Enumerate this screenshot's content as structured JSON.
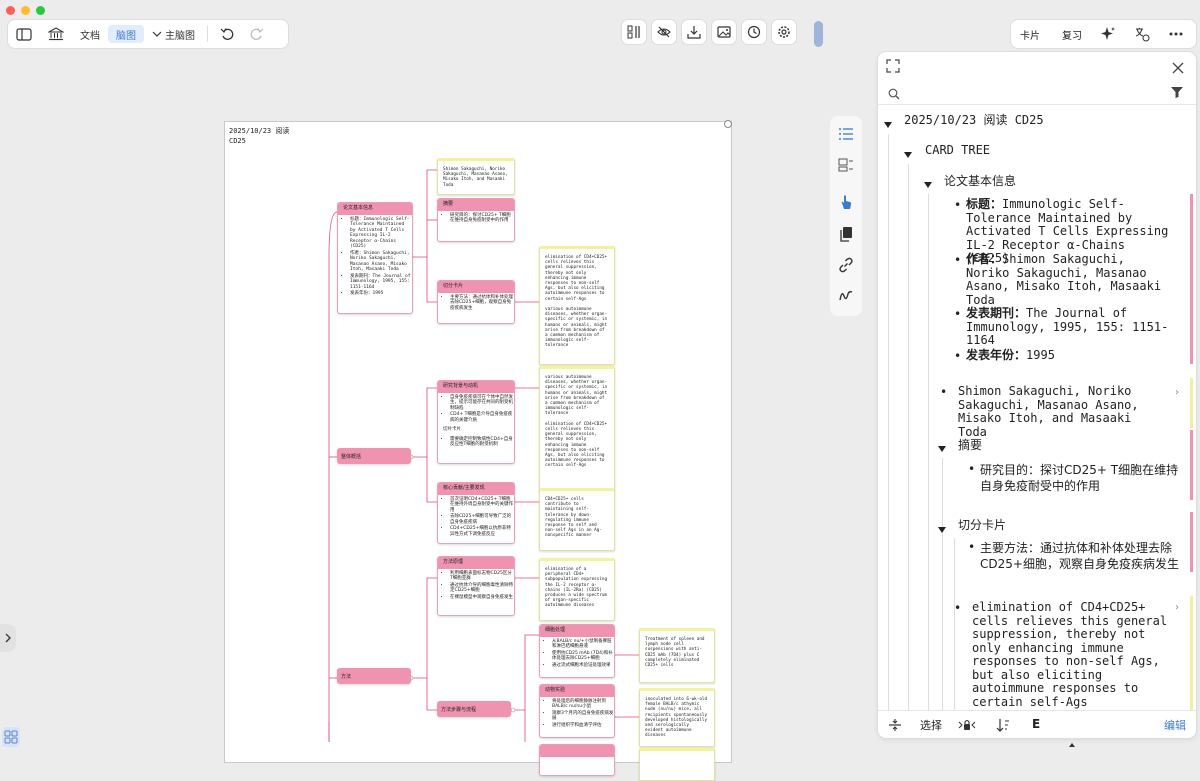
{
  "toolbar": {
    "doc_label": "文档",
    "mindmap_label": "脑图",
    "main_map_label": "主脑图",
    "card_label": "卡片",
    "review_label": "复习"
  },
  "board": {
    "title": "2025/10/23 阅读",
    "subtitle": "CD25",
    "nodes": {
      "basic_info": {
        "title": "论文基本信息",
        "items": [
          "标题：Immunologic Self-Tolerance Maintained by Activated T Cells Expressing IL-2 Receptor α-Chains (CD25)",
          "作者：Shimon Sakaguchi, Noriko Sakaguchi, Masanao Asano, Misako Itoh, Masaaki Toda",
          "发表期刊：The Journal of Immunology, 1995, 155: 1151-1164",
          "发表年份：1995"
        ]
      },
      "authors_leaf": "Shimon Sakaguchi, Noriko Sakaguchi, Masanao Asano, Misako Itoh, and Masaaki Toda",
      "abstract": {
        "title": "摘要",
        "items": [
          "研究目的：探讨CD25+ T细胞在维持自身免疫耐受中的作用"
        ]
      },
      "cut_card": {
        "title": "切分卡片",
        "items": [
          "主要方法：通过抗体和补体处理去除CD25+细胞，观察自身免疫疾病发生"
        ]
      },
      "leaf_elim1": "elimination of CD4+CD25+ cells relieves this general suppression, thereby not only enhancing immune responses to non-self Ags, but also eliciting autoimmune responses to certain self-Ags\n\nvarious autoimmune diseases, whether organ-specific or systemic, in humans or animals, might arise from breakdown of a common mechanism of immunologic self-tolerance",
      "background": {
        "title": "研究背景与动机",
        "items": [
          "自身免疫疾病可在个体中自然发生，提示可能存在共同的耐受机制缺陷",
          "CD4+ T细胞是介导自身免疫疾病的关键介质"
        ],
        "sub_label": "切片卡片",
        "sub_items": [
          "需要确定控制致病性CD4+自身反应性T细胞的耐受机制"
        ]
      },
      "leaf_various": "various autoimmune diseases, whether organ-specific or systemic, in humans or animals, might arise from breakdown of a common mechanism of immunologic self-tolerance\n\nelimination of CD4+CD25+ cells relieves this general suppression, thereby not only enhancing immune responses to non-self Ags, but also eliciting autoimmune responses to certain self-Ags",
      "core": {
        "title": "核心贡献/主要发现",
        "items": [
          "首次证明CD4+CD25+ T细胞在维持外周自身耐受中的关键作用",
          "去除CD25+细胞可导致广泛的自身免疫疾病",
          "CD4+CD25+细胞以抗原非特异性方式下调免疫反应"
        ]
      },
      "leaf_cd4": "CD4+CD25+ cells contribute to maintaining self-tolerance by down-regulating immune response to self and non-self Ags in an Ag-nonspecific manner",
      "principle": {
        "title": "方法原理",
        "items": [
          "利用细胞表面标志物CD25区分T细胞亚群",
          "通过抗体介导的细胞毒性清除特定CD25+细胞",
          "在裸鼠模型中观察自身免疫发生"
        ]
      },
      "leaf_principle": "elimination of a peripheral CD4+ subpopulation expressing the IL-2 receptor α-chains (IL-2Rα) (CD25) produces a wide spectrum of organ-specific autoimmune diseases",
      "cell_proc": {
        "title": "细胞处理",
        "items": [
          "从BALB/c nu/+小鼠制备脾脏和淋巴结细胞悬液",
          "使用抗CD25 mAb (7D4)和补体处理去除CD25+细胞",
          "通过流式细胞术验证处理效果"
        ]
      },
      "leaf_cell": "Treatment of spleen and lymph node cell suspensions with anti-CD25 mAb (7D4) plus C completely eliminated CD25+ cells",
      "animal": {
        "title": "动物实验",
        "items": [
          "将处理后的细胞静脉注射到BALB/c nu/nu小鼠",
          "观察3个月内的自身免疫疾病发展",
          "进行组织学和血清学评估"
        ]
      },
      "leaf_animal": "inoculated into 6-wk-old female BALB/c athymic nude (nu/nu) mice, all recipients spontaneously developed histologically and serologically evident autoimmune diseases",
      "overview_label": "整体概括",
      "method_label": "方法",
      "steps_label": "方法步骤与流程"
    }
  },
  "panel": {
    "root": "2025/10/23 阅读 CD25",
    "card_tree": "CARD TREE",
    "basic_info": "论文基本信息",
    "info": [
      {
        "k": "标题：",
        "v": "Immunologic Self-Tolerance Maintained by Activated T Cells Expressing IL-2 Receptor α-Chains (CD25)"
      },
      {
        "k": "作者：",
        "v": "Shimon Sakaguchi, Noriko Sakaguchi, Masanao Asano, Misako Itoh, Masaaki Toda"
      },
      {
        "k": "发表期刊：",
        "v": "The Journal of Immunology, 1995, 155: 1151-1164"
      },
      {
        "k": "发表年份：",
        "v": "1995"
      }
    ],
    "authors_card": "Shimon Sakaguchi, Noriko Sakaguchi, Masanao Asano, Misako Itoh, and Masaaki Toda",
    "abstract": "摘要",
    "abstract_item": "研究目的：探讨CD25+ T细胞在维持自身免疫耐受中的作用",
    "cut_card": "切分卡片",
    "cut_item": "主要方法：通过抗体和补体处理去除CD25+细胞，观察自身免疫疾病发生",
    "elim_card": "elimination of CD4+CD25+ cells relieves this general suppression, thereby not only enhancing immune responses to non-self Ags, but also eliciting autoimmune responses to certain self-Ags",
    "bottom": {
      "select_label": "选择",
      "edit_label": "编辑"
    }
  },
  "colors": {
    "accent": "#3a7bd5",
    "node_header": "#ef93b1",
    "leaf_top": "#f3f39a"
  }
}
